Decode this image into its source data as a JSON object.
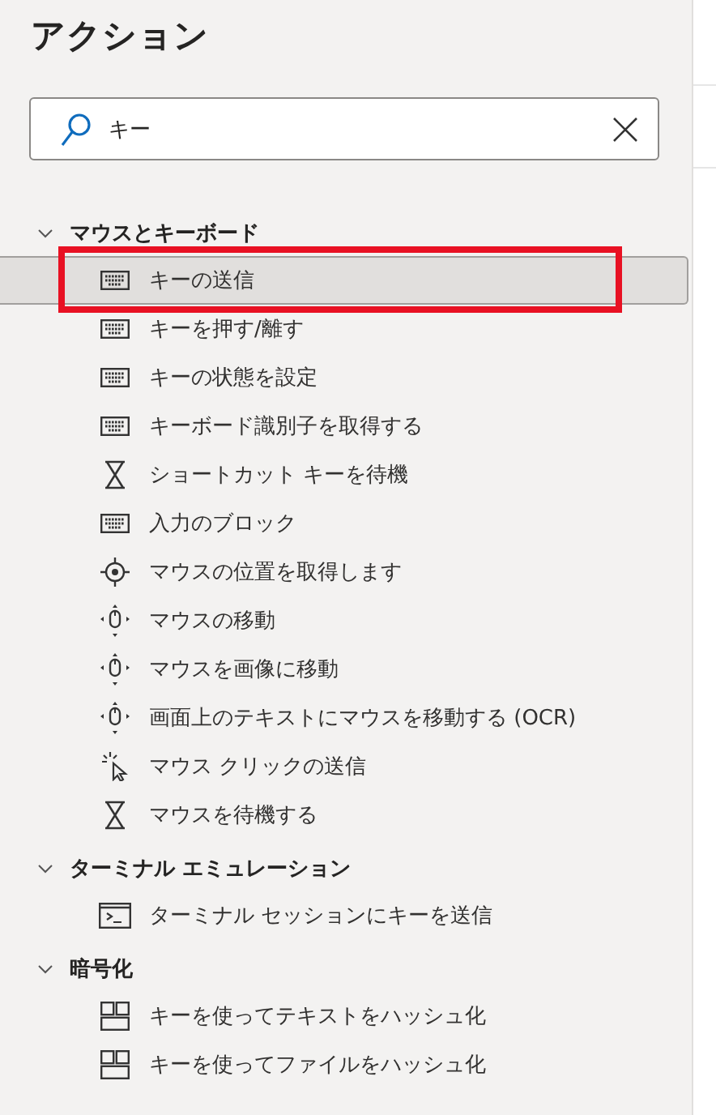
{
  "panel": {
    "title": "アクション"
  },
  "search": {
    "value": "キー"
  },
  "groups": [
    {
      "label": "マウスとキーボード",
      "expanded": true,
      "children": [
        {
          "label": "キーの送信",
          "kind": "keyboard",
          "selected": true,
          "annotated": true
        },
        {
          "label": "キーを押す/離す",
          "kind": "keyboard",
          "selected": false,
          "annotated": false
        },
        {
          "label": "キーの状態を設定",
          "kind": "keyboard",
          "selected": false,
          "annotated": false
        },
        {
          "label": "キーボード識別子を取得する",
          "kind": "keyboard",
          "selected": false,
          "annotated": false
        },
        {
          "label": "ショートカット キーを待機",
          "kind": "hourglass",
          "selected": false,
          "annotated": false
        },
        {
          "label": "入力のブロック",
          "kind": "keyboard",
          "selected": false,
          "annotated": false
        },
        {
          "label": "マウスの位置を取得します",
          "kind": "target",
          "selected": false,
          "annotated": false
        },
        {
          "label": "マウスの移動",
          "kind": "mouse",
          "selected": false,
          "annotated": false
        },
        {
          "label": "マウスを画像に移動",
          "kind": "mouse",
          "selected": false,
          "annotated": false
        },
        {
          "label": "画面上のテキストにマウスを移動する (OCR)",
          "kind": "mouse",
          "selected": false,
          "annotated": false
        },
        {
          "label": "マウス クリックの送信",
          "kind": "click",
          "selected": false,
          "annotated": false
        },
        {
          "label": "マウスを待機する",
          "kind": "hourglass",
          "selected": false,
          "annotated": false
        }
      ]
    },
    {
      "label": "ターミナル エミュレーション",
      "expanded": true,
      "children": [
        {
          "label": "ターミナル セッションにキーを送信",
          "kind": "terminal",
          "selected": false,
          "annotated": false
        }
      ]
    },
    {
      "label": "暗号化",
      "expanded": true,
      "children": [
        {
          "label": "キーを使ってテキストをハッシュ化",
          "kind": "grid",
          "selected": false,
          "annotated": false
        },
        {
          "label": "キーを使ってファイルをハッシュ化",
          "kind": "grid",
          "selected": false,
          "annotated": false
        }
      ]
    }
  ]
}
